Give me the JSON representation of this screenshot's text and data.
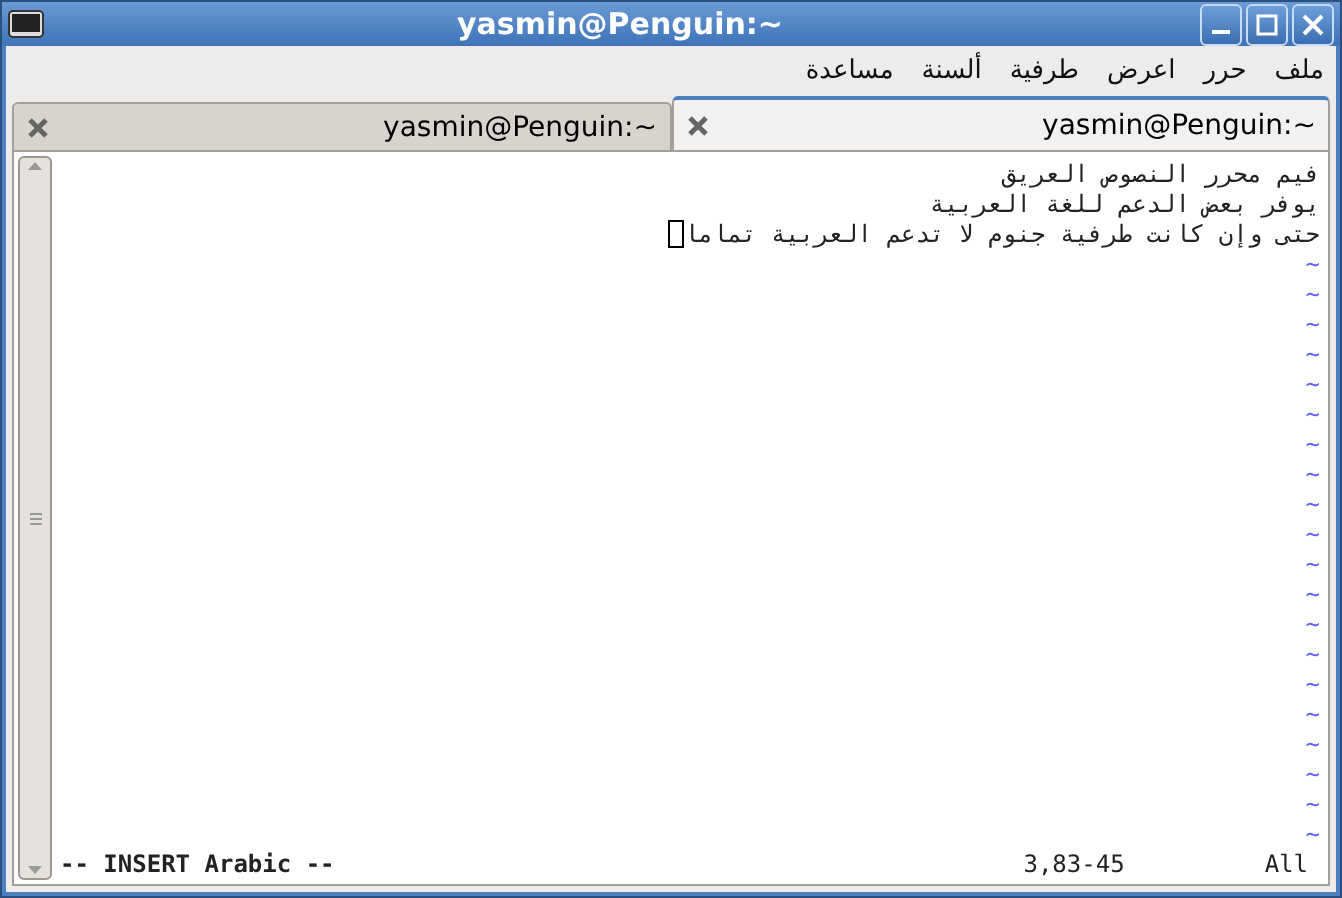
{
  "window": {
    "title": "yasmin@Penguin:~"
  },
  "menu": [
    "ملف",
    "حرر",
    "اعرض",
    "طرفية",
    "ألسنة",
    "مساعدة"
  ],
  "tabs": [
    {
      "label": "yasmin@Penguin:~",
      "selected": true
    },
    {
      "label": "yasmin@Penguin:~",
      "selected": false
    }
  ],
  "editor": {
    "lines": [
      "فيم محرر النصوص العريق",
      "يوفر بعض الدعم للغة العربية",
      "حتى وإن كانت طرفية جنوم لا تدعم العربية تماما"
    ],
    "empty_line_markers": [
      "~",
      "~",
      "~",
      "~",
      "~",
      "~",
      "~",
      "~",
      "~",
      "~",
      "~",
      "~",
      "~",
      "~",
      "~",
      "~",
      "~",
      "~",
      "~",
      "~"
    ],
    "status": {
      "mode": "-- INSERT Arabic --",
      "position": "3,83-45",
      "scroll": "All"
    }
  }
}
